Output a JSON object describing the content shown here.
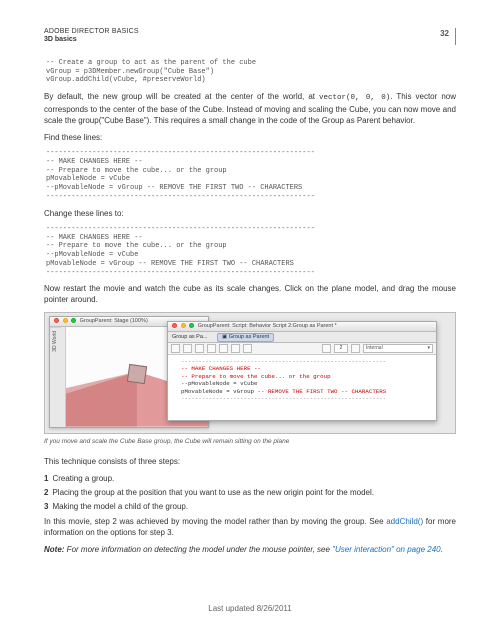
{
  "header": {
    "title": "ADOBE DIRECTOR BASICS",
    "subtitle": "3D basics",
    "page_number": "32"
  },
  "code1": "-- Create a group to act as the parent of the cube\nvGroup = p3DMember.newGroup(\"Cube Base\")\nvGroup.addChild(vCube, #preserveWorld)",
  "para1_a": "By default, the new group will be created at the center of the world, at ",
  "para1_vec": "vector(0, 0, 0)",
  "para1_b": ". This vector now corresponds to the center of the base of the Cube. Instead of moving and scaling the Cube, you can now move and scale the group(\"Cube Base\"). This requires a small change in the code of the Group as Parent behavior.",
  "para2": "Find these lines:",
  "code2": "----------------------------------------------------------------\n-- MAKE CHANGES HERE --\n-- Prepare to move the cube... or the group\npMovableNode = vCube\n--pMovableNode = vGroup -- REMOVE THE FIRST TWO -- CHARACTERS\n----------------------------------------------------------------",
  "para3": "Change these lines to:",
  "code3": "----------------------------------------------------------------\n-- MAKE CHANGES HERE --\n-- Prepare to move the cube... or the group\n--pMovableNode = vCube\npMovableNode = vGroup -- REMOVE THE FIRST TWO -- CHARACTERS\n----------------------------------------------------------------",
  "para4": "Now restart the movie and watch the cube as its scale changes. Click on the plane model, and drag the mouse pointer around.",
  "figure": {
    "stage_title": "GroupParent: Stage (100%)",
    "stage_tab": "3D World",
    "script_title": "GroupParent: Script: Behavior Script 2:Group as Parent *",
    "tab_label": "Group as Pa...",
    "tab_chip": "Group as Parent",
    "combo_value": "Internal",
    "spin_value": "2",
    "script_lines": {
      "l1_pre": "  ",
      "l1": "-- MAKE CHANGES HERE --",
      "l2_pre": "  ",
      "l2": "-- Prepare to move the cube... or the group",
      "l3_pre": "  ",
      "l3a": "--",
      "l3b": "pMovableNode = vCube",
      "l4_pre": "  ",
      "l4a": "pMovableNode = vGroup ",
      "l4b": "-- REMOVE THE FIRST TWO -- CHARACTERS"
    }
  },
  "caption": "If you move and scale the Cube Base group, the Cube will remain sitting on the plane",
  "para5": "This technique consists of three steps:",
  "steps": {
    "s1": "Creating a group.",
    "s2": "Placing the group at the position that you want to use as the new origin point for the model.",
    "s3": "Making the model a child of the group."
  },
  "para6_a": "In this movie, step 2 was achieved by moving the model rather than by moving the group. See ",
  "para6_link": "addChild()",
  "para6_b": " for more information on the options for step 3.",
  "note_label": "Note:",
  "note_a": " For more information on detecting the model under the mouse pointer, see ",
  "note_link": "\"User interaction\" on page 240",
  "note_b": ".",
  "footer": "Last updated 8/26/2011"
}
